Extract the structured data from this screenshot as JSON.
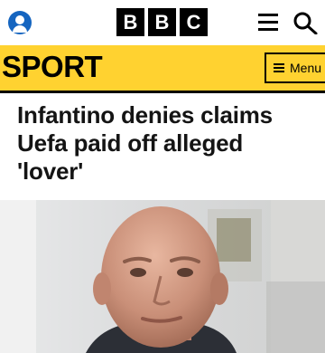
{
  "header": {
    "logo_letters": [
      "B",
      "B",
      "C"
    ],
    "account_icon": "account-icon",
    "menu_icon": "menu-icon",
    "search_icon": "search-icon"
  },
  "section": {
    "title": "SPORT",
    "menu_label": "Menu",
    "menu_icon": "hamburger-icon",
    "bar_color": "#ffd230"
  },
  "article": {
    "headline": "Infantino denies claims Uefa paid off alleged 'lover'",
    "image_alt": "Photo of a bald man in a suit"
  },
  "colors": {
    "account": "#1565c0",
    "logo": "#000000",
    "sport_bar": "#ffd230"
  }
}
